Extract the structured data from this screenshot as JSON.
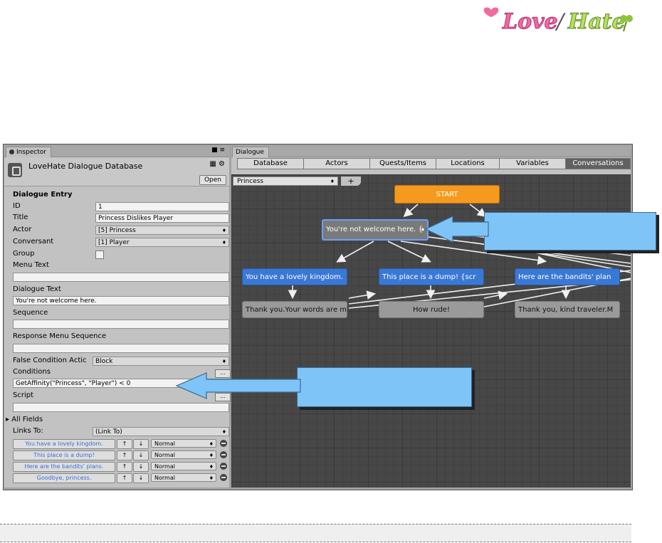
{
  "logo": {
    "text": "Love/Hate"
  },
  "inspector": {
    "tab": "Inspector",
    "title": "LoveHate Dialogue Database",
    "open_label": "Open",
    "section": "Dialogue Entry",
    "fields": {
      "id_label": "ID",
      "id_value": "1",
      "title_label": "Title",
      "title_value": "Princess Dislikes Player",
      "actor_label": "Actor",
      "actor_value": "[5] Princess",
      "conversant_label": "Conversant",
      "conversant_value": "[1] Player",
      "group_label": "Group",
      "menu_text_label": "Menu Text",
      "menu_text_value": "",
      "dialogue_text_label": "Dialogue Text",
      "dialogue_text_value": "You're not welcome here.",
      "sequence_label": "Sequence",
      "sequence_value": "",
      "response_menu_label": "Response Menu Sequence",
      "response_menu_value": "",
      "false_condition_label": "False Condition Actic",
      "false_condition_value": "Block",
      "conditions_label": "Conditions",
      "conditions_value": "GetAffinity(\"Princess\", \"Player\") < 0",
      "script_label": "Script",
      "script_value": "",
      "all_fields_label": "All Fields",
      "links_to_label": "Links To:",
      "links_to_value": "(Link To)"
    },
    "links": [
      {
        "label": "You have a lovely kingdom.",
        "priority": "Normal"
      },
      {
        "label": "This place is a dump!",
        "priority": "Normal"
      },
      {
        "label": "Here are the bandits' plans.",
        "priority": "Normal"
      },
      {
        "label": "Goodbye, princess.",
        "priority": "Normal"
      }
    ],
    "dots_label": "..."
  },
  "editor": {
    "tab": "Dialogue",
    "toolbar": [
      "Database",
      "Actors",
      "Quests/Items",
      "Locations",
      "Variables",
      "Conversations"
    ],
    "active_tab": "Conversations",
    "conversation": "Princess",
    "plus_label": "+",
    "nodes": {
      "start": "START",
      "welcome": "You're not welcome here. {",
      "lovely": "You have a lovely kingdom.",
      "dump": "This place is a dump! {scr",
      "bandits": "Here are the bandits' plan",
      "thankyou": "Thank you.Your words are m",
      "rude": "How rude!",
      "traveler": "Thank you, kind traveler.M"
    }
  },
  "colors": {
    "accent_orange": "#f59a1e",
    "node_blue": "#3a78d6",
    "callout_blue": "#7fc4f7"
  }
}
